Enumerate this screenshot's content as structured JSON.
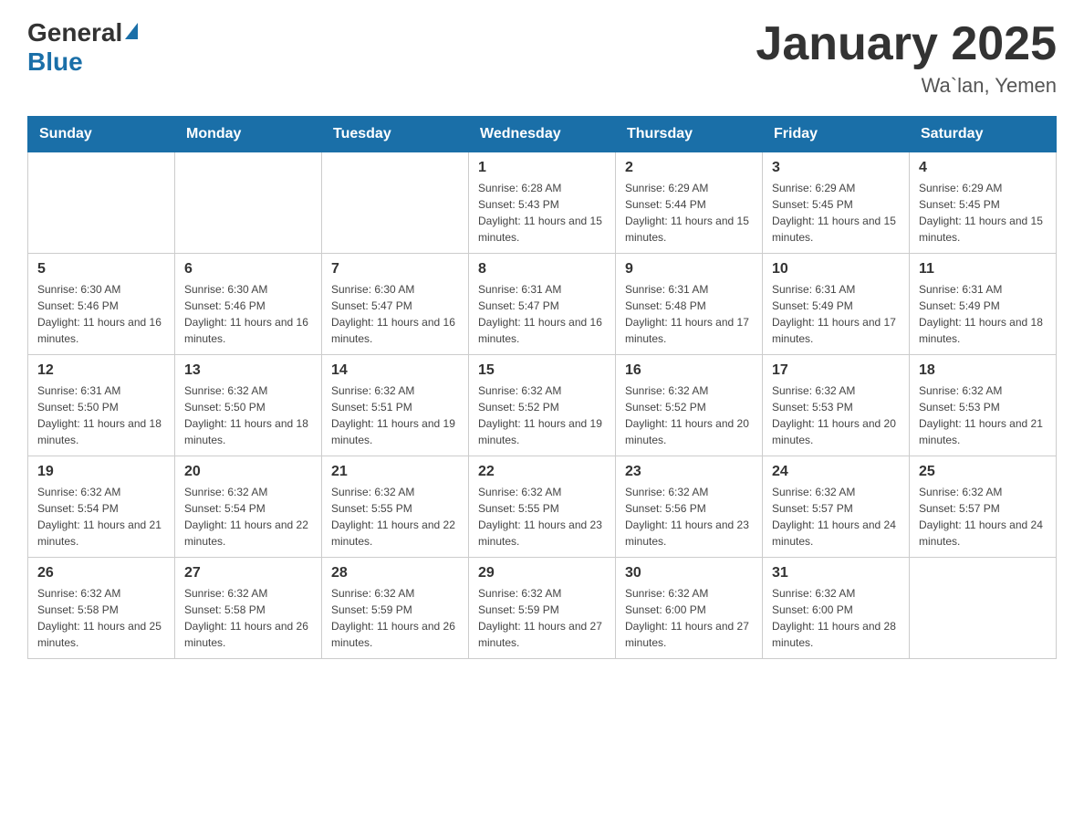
{
  "header": {
    "logo_general": "General",
    "logo_blue": "Blue",
    "month_title": "January 2025",
    "location": "Wa`lan, Yemen"
  },
  "days_of_week": [
    "Sunday",
    "Monday",
    "Tuesday",
    "Wednesday",
    "Thursday",
    "Friday",
    "Saturday"
  ],
  "weeks": [
    [
      {
        "day": "",
        "info": ""
      },
      {
        "day": "",
        "info": ""
      },
      {
        "day": "",
        "info": ""
      },
      {
        "day": "1",
        "info": "Sunrise: 6:28 AM\nSunset: 5:43 PM\nDaylight: 11 hours and 15 minutes."
      },
      {
        "day": "2",
        "info": "Sunrise: 6:29 AM\nSunset: 5:44 PM\nDaylight: 11 hours and 15 minutes."
      },
      {
        "day": "3",
        "info": "Sunrise: 6:29 AM\nSunset: 5:45 PM\nDaylight: 11 hours and 15 minutes."
      },
      {
        "day": "4",
        "info": "Sunrise: 6:29 AM\nSunset: 5:45 PM\nDaylight: 11 hours and 15 minutes."
      }
    ],
    [
      {
        "day": "5",
        "info": "Sunrise: 6:30 AM\nSunset: 5:46 PM\nDaylight: 11 hours and 16 minutes."
      },
      {
        "day": "6",
        "info": "Sunrise: 6:30 AM\nSunset: 5:46 PM\nDaylight: 11 hours and 16 minutes."
      },
      {
        "day": "7",
        "info": "Sunrise: 6:30 AM\nSunset: 5:47 PM\nDaylight: 11 hours and 16 minutes."
      },
      {
        "day": "8",
        "info": "Sunrise: 6:31 AM\nSunset: 5:47 PM\nDaylight: 11 hours and 16 minutes."
      },
      {
        "day": "9",
        "info": "Sunrise: 6:31 AM\nSunset: 5:48 PM\nDaylight: 11 hours and 17 minutes."
      },
      {
        "day": "10",
        "info": "Sunrise: 6:31 AM\nSunset: 5:49 PM\nDaylight: 11 hours and 17 minutes."
      },
      {
        "day": "11",
        "info": "Sunrise: 6:31 AM\nSunset: 5:49 PM\nDaylight: 11 hours and 18 minutes."
      }
    ],
    [
      {
        "day": "12",
        "info": "Sunrise: 6:31 AM\nSunset: 5:50 PM\nDaylight: 11 hours and 18 minutes."
      },
      {
        "day": "13",
        "info": "Sunrise: 6:32 AM\nSunset: 5:50 PM\nDaylight: 11 hours and 18 minutes."
      },
      {
        "day": "14",
        "info": "Sunrise: 6:32 AM\nSunset: 5:51 PM\nDaylight: 11 hours and 19 minutes."
      },
      {
        "day": "15",
        "info": "Sunrise: 6:32 AM\nSunset: 5:52 PM\nDaylight: 11 hours and 19 minutes."
      },
      {
        "day": "16",
        "info": "Sunrise: 6:32 AM\nSunset: 5:52 PM\nDaylight: 11 hours and 20 minutes."
      },
      {
        "day": "17",
        "info": "Sunrise: 6:32 AM\nSunset: 5:53 PM\nDaylight: 11 hours and 20 minutes."
      },
      {
        "day": "18",
        "info": "Sunrise: 6:32 AM\nSunset: 5:53 PM\nDaylight: 11 hours and 21 minutes."
      }
    ],
    [
      {
        "day": "19",
        "info": "Sunrise: 6:32 AM\nSunset: 5:54 PM\nDaylight: 11 hours and 21 minutes."
      },
      {
        "day": "20",
        "info": "Sunrise: 6:32 AM\nSunset: 5:54 PM\nDaylight: 11 hours and 22 minutes."
      },
      {
        "day": "21",
        "info": "Sunrise: 6:32 AM\nSunset: 5:55 PM\nDaylight: 11 hours and 22 minutes."
      },
      {
        "day": "22",
        "info": "Sunrise: 6:32 AM\nSunset: 5:55 PM\nDaylight: 11 hours and 23 minutes."
      },
      {
        "day": "23",
        "info": "Sunrise: 6:32 AM\nSunset: 5:56 PM\nDaylight: 11 hours and 23 minutes."
      },
      {
        "day": "24",
        "info": "Sunrise: 6:32 AM\nSunset: 5:57 PM\nDaylight: 11 hours and 24 minutes."
      },
      {
        "day": "25",
        "info": "Sunrise: 6:32 AM\nSunset: 5:57 PM\nDaylight: 11 hours and 24 minutes."
      }
    ],
    [
      {
        "day": "26",
        "info": "Sunrise: 6:32 AM\nSunset: 5:58 PM\nDaylight: 11 hours and 25 minutes."
      },
      {
        "day": "27",
        "info": "Sunrise: 6:32 AM\nSunset: 5:58 PM\nDaylight: 11 hours and 26 minutes."
      },
      {
        "day": "28",
        "info": "Sunrise: 6:32 AM\nSunset: 5:59 PM\nDaylight: 11 hours and 26 minutes."
      },
      {
        "day": "29",
        "info": "Sunrise: 6:32 AM\nSunset: 5:59 PM\nDaylight: 11 hours and 27 minutes."
      },
      {
        "day": "30",
        "info": "Sunrise: 6:32 AM\nSunset: 6:00 PM\nDaylight: 11 hours and 27 minutes."
      },
      {
        "day": "31",
        "info": "Sunrise: 6:32 AM\nSunset: 6:00 PM\nDaylight: 11 hours and 28 minutes."
      },
      {
        "day": "",
        "info": ""
      }
    ]
  ]
}
